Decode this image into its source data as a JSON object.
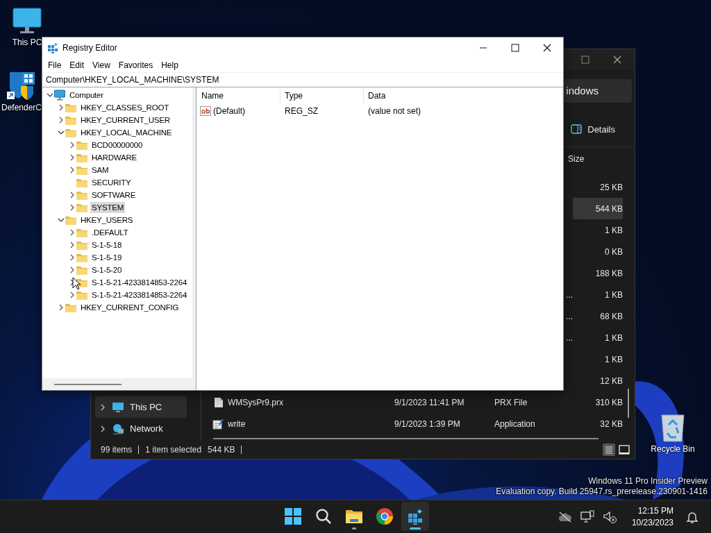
{
  "desktop": {
    "icons": [
      {
        "kind": "computer",
        "label": "This PC"
      },
      {
        "kind": "shield",
        "label": "DefenderC"
      },
      {
        "kind": "recycle",
        "label": "Recycle Bin"
      }
    ]
  },
  "explorer": {
    "address": "indows",
    "details_button": "Details",
    "size_header": "Size",
    "rows": [
      {
        "size": "25 KB",
        "selected": false
      },
      {
        "size": "544 KB",
        "selected": true
      },
      {
        "size": "1 KB",
        "selected": false
      },
      {
        "size": "0 KB",
        "selected": false
      },
      {
        "size": "188 KB",
        "selected": false
      },
      {
        "size": "1 KB",
        "type": "...",
        "selected": false
      },
      {
        "size": "68 KB",
        "type": "...",
        "selected": false
      },
      {
        "size": "1 KB",
        "type": "...",
        "selected": false
      },
      {
        "size": "1 KB",
        "selected": false
      },
      {
        "size": "12 KB",
        "selected": false
      },
      {
        "kind": "file",
        "name": "WMSysPr9.prx",
        "date": "9/1/2023 11:41 PM",
        "type": "PRX File",
        "size": "310 KB",
        "selected": false
      },
      {
        "kind": "app",
        "name": "write",
        "date": "9/1/2023 1:39 PM",
        "type": "Application",
        "size": "32 KB",
        "selected": false
      }
    ],
    "sidebar": [
      {
        "kind": "pc",
        "label": "This PC",
        "selected": true
      },
      {
        "kind": "network",
        "label": "Network",
        "selected": false
      }
    ],
    "status": {
      "items": "99 items",
      "selection": "1 item selected",
      "size": "544 KB"
    }
  },
  "registry_editor": {
    "title": "Registry Editor",
    "menu": [
      "File",
      "Edit",
      "View",
      "Favorites",
      "Help"
    ],
    "address": "Computer\\HKEY_LOCAL_MACHINE\\SYSTEM",
    "tree": [
      {
        "kind": "computer",
        "label": "Computer",
        "expanded": true,
        "selected": false,
        "children": [
          {
            "label": "HKEY_CLASSES_ROOT",
            "expanded": false,
            "selected": false
          },
          {
            "label": "HKEY_CURRENT_USER",
            "expanded": false,
            "selected": false
          },
          {
            "label": "HKEY_LOCAL_MACHINE",
            "expanded": true,
            "selected": false,
            "children": [
              {
                "label": "BCD00000000",
                "expanded": false,
                "selected": false
              },
              {
                "label": "HARDWARE",
                "expanded": false,
                "selected": false
              },
              {
                "label": "SAM",
                "expanded": false,
                "selected": false
              },
              {
                "label": "SECURITY",
                "expandable": false,
                "selected": false
              },
              {
                "label": "SOFTWARE",
                "expanded": false,
                "selected": false
              },
              {
                "label": "SYSTEM",
                "expanded": false,
                "selected": true
              }
            ]
          },
          {
            "label": "HKEY_USERS",
            "expanded": true,
            "selected": false,
            "children": [
              {
                "label": ".DEFAULT",
                "expanded": false,
                "selected": false
              },
              {
                "label": "S-1-5-18",
                "expanded": false,
                "selected": false
              },
              {
                "label": "S-1-5-19",
                "expanded": false,
                "selected": false
              },
              {
                "label": "S-1-5-20",
                "expanded": false,
                "selected": false
              },
              {
                "label": "S-1-5-21-4233814853-2264",
                "expanded": false,
                "selected": false
              },
              {
                "label": "S-1-5-21-4233814853-2264",
                "expanded": false,
                "selected": false
              }
            ]
          },
          {
            "label": "HKEY_CURRENT_CONFIG",
            "expanded": false,
            "selected": false
          }
        ]
      }
    ],
    "columns": [
      "Name",
      "Type",
      "Data"
    ],
    "values": [
      {
        "name": "(Default)",
        "type": "REG_SZ",
        "data": "(value not set)"
      }
    ]
  },
  "system_notice": [
    "Windows 11 Pro Insider Preview",
    "Evaluation copy. Build 25947.rs_prerelease.230901-1416"
  ],
  "taskbar": {
    "apps": [
      {
        "kind": "start",
        "running": false,
        "active": false
      },
      {
        "kind": "search",
        "running": false,
        "active": false
      },
      {
        "kind": "explorer",
        "running": true,
        "active": false
      },
      {
        "kind": "chrome",
        "running": false,
        "active": false
      },
      {
        "kind": "regedit",
        "running": true,
        "active": true
      }
    ],
    "time": "12:15 PM",
    "date": "10/23/2023"
  }
}
